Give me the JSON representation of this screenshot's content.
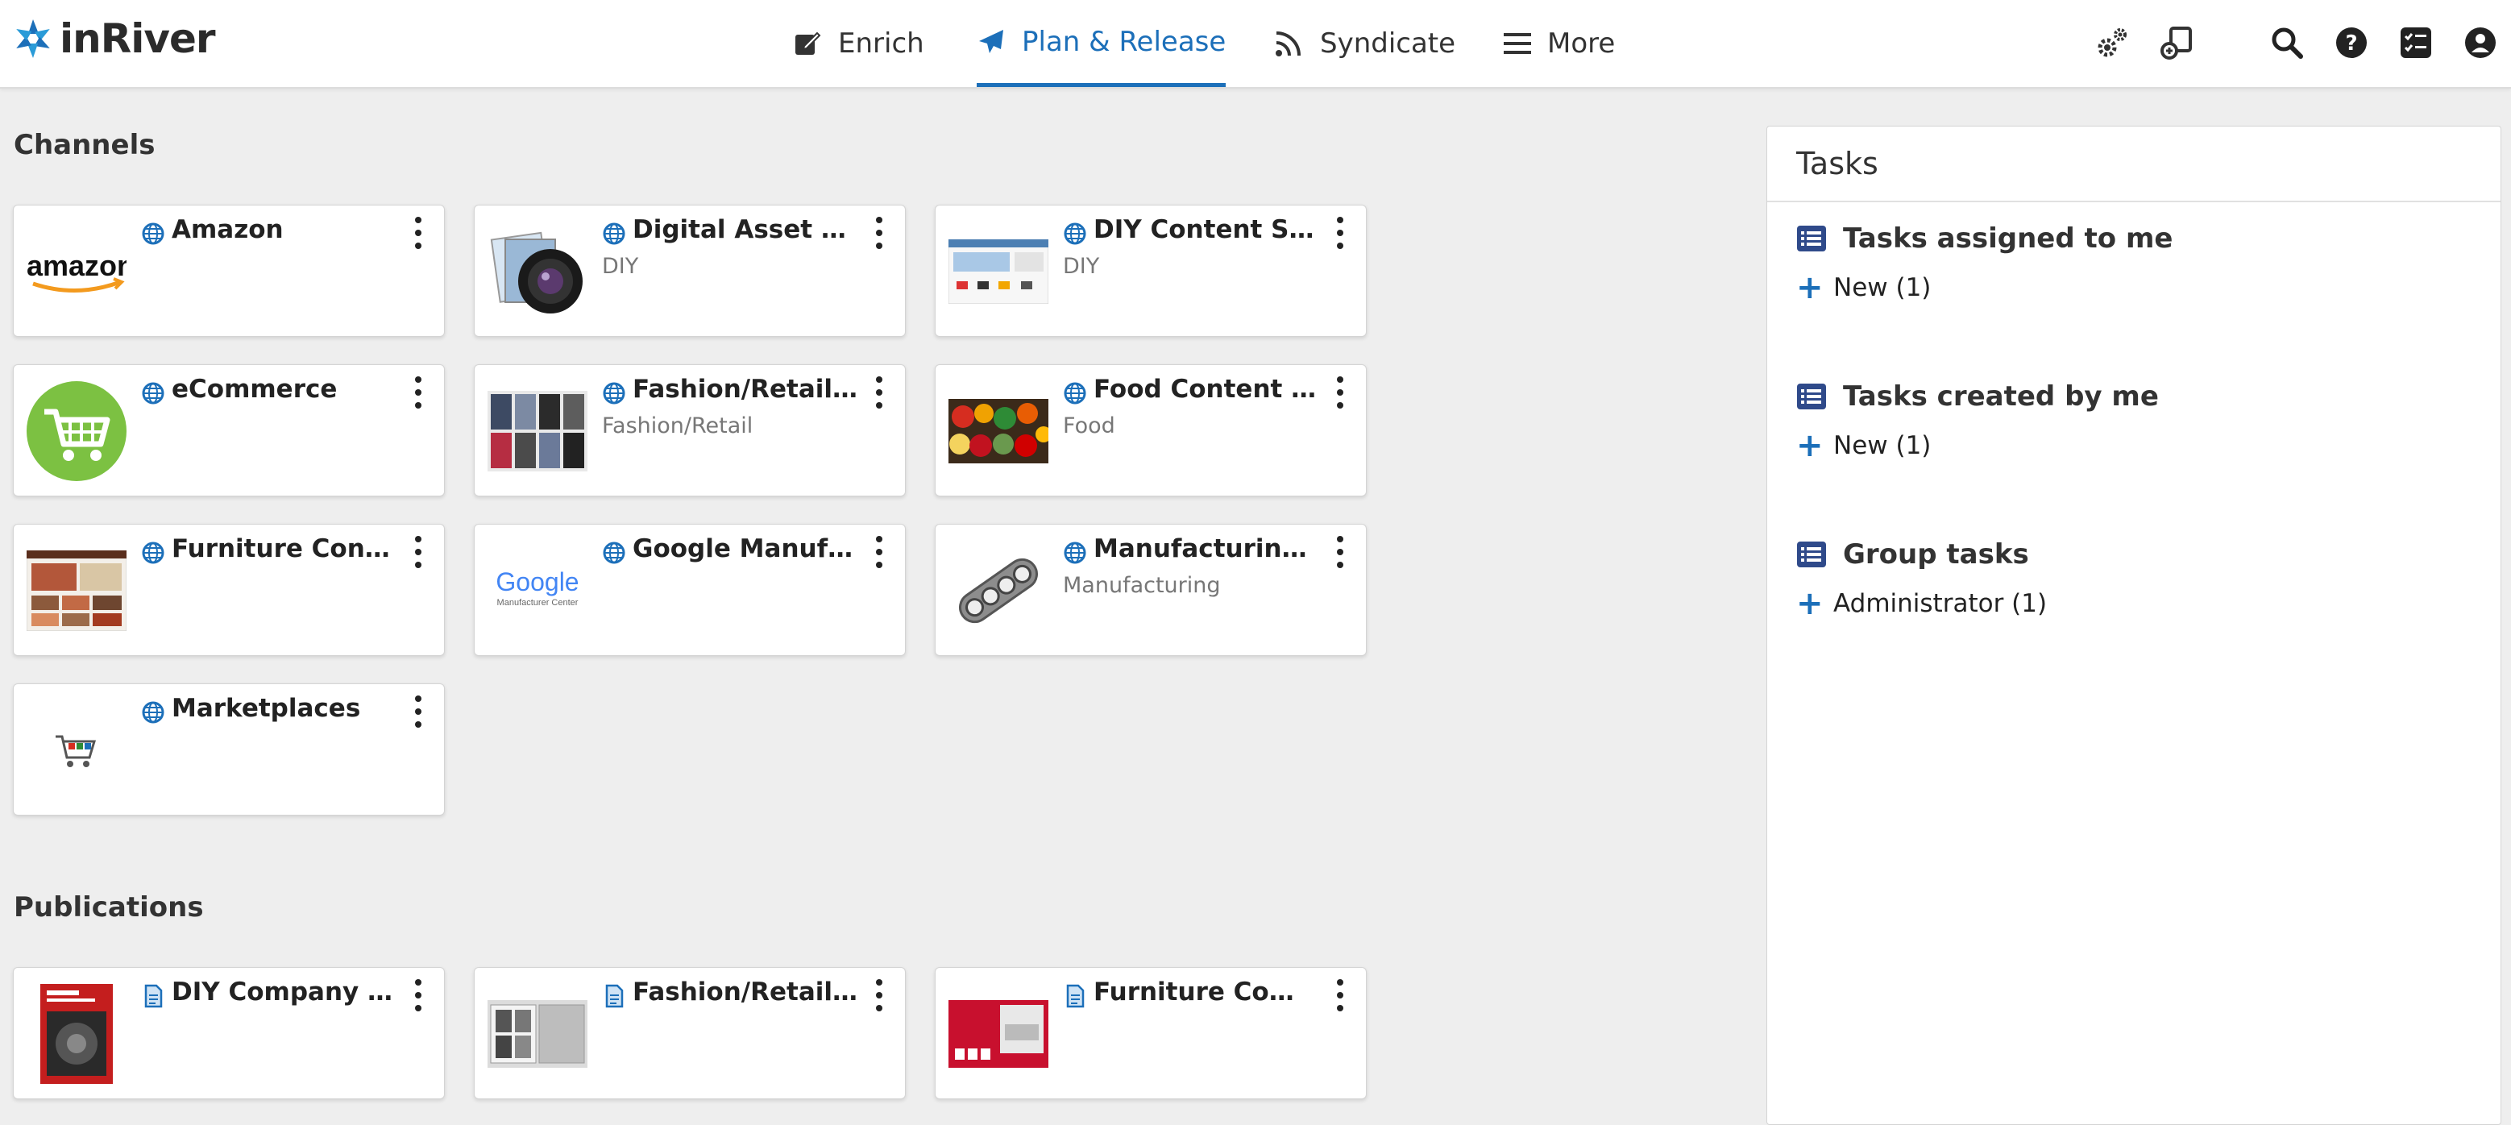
{
  "app": {
    "logo_text": "inRiver"
  },
  "nav": {
    "items": [
      {
        "label": "Enrich",
        "icon": "edit-icon"
      },
      {
        "label": "Plan & Release",
        "icon": "paper-plane-icon",
        "active": true
      },
      {
        "label": "Syndicate",
        "icon": "rss-icon"
      },
      {
        "label": "More",
        "icon": "hamburger-menu-icon"
      }
    ]
  },
  "toolbar": {
    "icons": [
      "settings-gears-icon",
      "import-icon",
      "search-icon",
      "help-icon",
      "task-checklist-icon",
      "user-account-icon"
    ]
  },
  "channels": {
    "title": "Channels",
    "items": [
      {
        "name": "Amazon",
        "subtitle": ""
      },
      {
        "name": "Digital Asset Con...",
        "subtitle": "DIY"
      },
      {
        "name": "DIY Content Store",
        "subtitle": "DIY"
      },
      {
        "name": "eCommerce",
        "subtitle": ""
      },
      {
        "name": "Fashion/Retail Co...",
        "subtitle": "Fashion/Retail"
      },
      {
        "name": "Food Content Sto...",
        "subtitle": "Food"
      },
      {
        "name": "Furniture Content...",
        "subtitle": ""
      },
      {
        "name": "Google Manufact...",
        "subtitle": ""
      },
      {
        "name": "Manufacturing Co...",
        "subtitle": "Manufacturing"
      },
      {
        "name": "Marketplaces",
        "subtitle": ""
      }
    ],
    "thumb_texts": {
      "amazon": "amazon",
      "google": "Google",
      "google_sub": "Manufacturer Center"
    }
  },
  "publications": {
    "title": "Publications",
    "items": [
      {
        "name": "DIY Company Pu..."
      },
      {
        "name": "Fashion/Retail Co..."
      },
      {
        "name": "Furniture Compa..."
      }
    ]
  },
  "tasks": {
    "title": "Tasks",
    "groups": [
      {
        "title": "Tasks assigned to me",
        "item": "New (1)"
      },
      {
        "title": "Tasks created by me",
        "item": "New (1)"
      },
      {
        "title": "Group tasks",
        "item": "Administrator (1)"
      }
    ]
  },
  "colors": {
    "accent": "#1c6fb9",
    "nav_text": "#333333",
    "background": "#eeeeee"
  }
}
